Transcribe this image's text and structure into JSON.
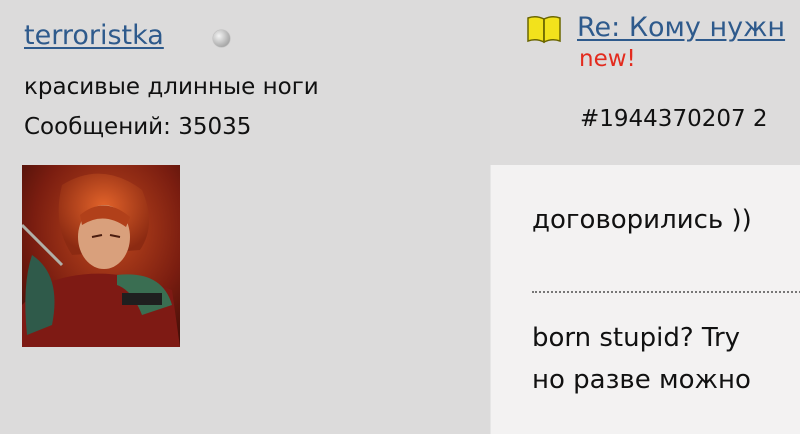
{
  "user": {
    "name": "terroristka",
    "title": "красивые длинные ноги",
    "posts_label": "Сообщений: 35035"
  },
  "post": {
    "title": "Re: Кому нужн",
    "new_label": "new!",
    "number": "#1944370207 2",
    "message": "договорились ))",
    "signature": [
      "born stupid? Try",
      "но разве можно"
    ]
  },
  "colors": {
    "link": "#2e5a8c",
    "new": "#e32b1e",
    "sidebar_bg": "#dcdbdb",
    "body_bg": "#f3f2f2"
  },
  "icons": {
    "status": "offline-status-icon",
    "post": "open-book-icon"
  }
}
